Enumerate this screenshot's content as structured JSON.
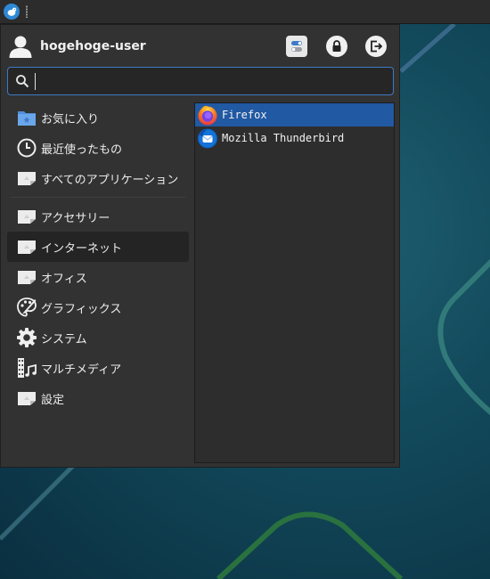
{
  "user": {
    "name": "hogehoge-user"
  },
  "header_buttons": [
    {
      "id": "settings",
      "icon": "settings-toggle-icon"
    },
    {
      "id": "lock",
      "icon": "lock-icon"
    },
    {
      "id": "logout",
      "icon": "logout-icon"
    }
  ],
  "search": {
    "value": "",
    "placeholder": ""
  },
  "categories": [
    {
      "label": "お気に入り",
      "icon": "favorites-folder-icon"
    },
    {
      "label": "最近使ったもの",
      "icon": "clock-icon"
    },
    {
      "label": "すべてのアプリケーション",
      "icon": "category-placeholder-icon"
    },
    {
      "label": "アクセサリー",
      "icon": "category-placeholder-icon"
    },
    {
      "label": "インターネット",
      "icon": "category-placeholder-icon",
      "active": true
    },
    {
      "label": "オフィス",
      "icon": "category-placeholder-icon"
    },
    {
      "label": "グラフィックス",
      "icon": "palette-icon"
    },
    {
      "label": "システム",
      "icon": "gear-icon"
    },
    {
      "label": "マルチメディア",
      "icon": "multimedia-icon"
    },
    {
      "label": "設定",
      "icon": "category-placeholder-icon"
    }
  ],
  "apps": [
    {
      "label": "Firefox",
      "icon": "firefox-icon",
      "selected": true
    },
    {
      "label": "Mozilla Thunderbird",
      "icon": "thunderbird-icon",
      "selected": false
    }
  ],
  "colors": {
    "accent": "#2159a3",
    "search_border": "#3d7bc4",
    "menu_bg": "#323232"
  }
}
